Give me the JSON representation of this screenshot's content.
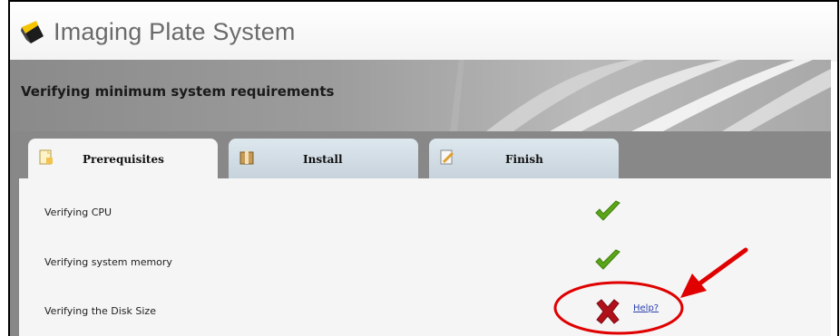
{
  "app": {
    "title": "Imaging Plate System"
  },
  "banner": {
    "title": "Verifying minimum system requirements"
  },
  "tabs": [
    {
      "label": "Prerequisites",
      "icon": "document-icon",
      "active": true
    },
    {
      "label": "Install",
      "icon": "box-icon",
      "active": false
    },
    {
      "label": "Finish",
      "icon": "document-edit-icon",
      "active": false
    }
  ],
  "checks": [
    {
      "label": "Verifying CPU",
      "status": "pass"
    },
    {
      "label": "Verifying system memory",
      "status": "pass"
    },
    {
      "label": "Verifying the Disk Size",
      "status": "fail",
      "help_label": "Help?"
    }
  ],
  "colors": {
    "pass": "#5aa617",
    "fail": "#b0101a",
    "annotation": "#e00000",
    "link": "#2a3fb0"
  }
}
